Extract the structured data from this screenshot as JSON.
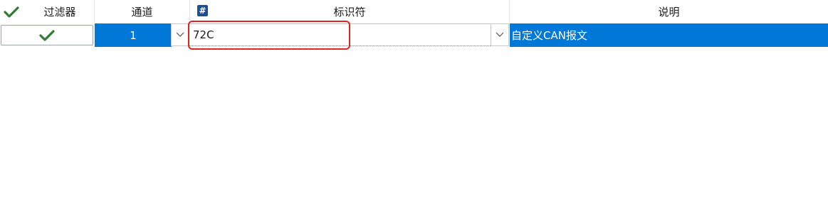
{
  "header": {
    "filter_label": "过滤器",
    "channel_label": "通道",
    "identifier_label": "标识符",
    "identifier_badge": "#",
    "description_label": "说明",
    "check_icon": "checkmark-icon"
  },
  "rows": [
    {
      "filter_enabled_icon": "checkmark-icon",
      "channel": "1",
      "identifier": "72C",
      "description": "自定义CAN报文"
    }
  ],
  "colors": {
    "selection": "#0078d7",
    "check": "#2e7d32",
    "badge": "#1e4f91",
    "highlight": "#e02424"
  }
}
